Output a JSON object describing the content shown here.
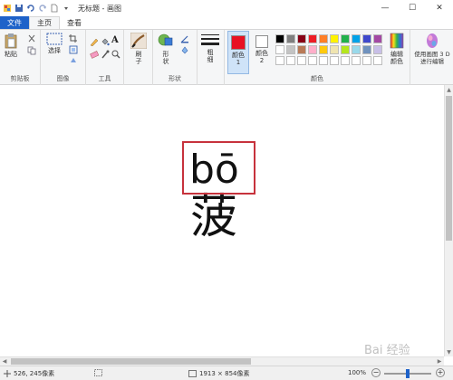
{
  "window": {
    "title": "无标题 - 画图",
    "controls": {
      "minimize": "—",
      "maximize": "☐",
      "close": "✕"
    }
  },
  "tabs": [
    {
      "label": "文件"
    },
    {
      "label": "主页"
    },
    {
      "label": "查看"
    }
  ],
  "ribbon": {
    "clipboard": {
      "paste_label": "粘贴",
      "group_label": "剪贴板"
    },
    "image": {
      "select_label": "选择",
      "group_label": "图像"
    },
    "tools": {
      "group_label": "工具",
      "text_glyph": "A"
    },
    "brushes": {
      "label": "刷子"
    },
    "shapes": {
      "shapes_label": "形状",
      "group_label": "形状"
    },
    "size": {
      "label": "粗细"
    },
    "colors": {
      "color1_label": "颜色 1",
      "color2_label": "颜色 2",
      "edit_label": "编辑颜色",
      "group_label": "颜色",
      "color1": "#e81123",
      "color2": "#ffffff",
      "palette_row1": [
        "#000000",
        "#7f7f7f",
        "#880015",
        "#ed1c24",
        "#ff7f27",
        "#fff200",
        "#22b14c",
        "#00a2e8",
        "#3f48cc",
        "#a349a4"
      ],
      "palette_row2": [
        "#ffffff",
        "#c3c3c3",
        "#b97a57",
        "#ffaec9",
        "#ffc90e",
        "#efe4b0",
        "#b5e61d",
        "#99d9ea",
        "#7092be",
        "#c8bfe7"
      ],
      "palette_row3": [
        "#ffffff",
        "#ffffff",
        "#ffffff",
        "#ffffff",
        "#ffffff",
        "#ffffff",
        "#ffffff",
        "#ffffff",
        "#ffffff",
        "#ffffff"
      ]
    },
    "paint3d": {
      "label": "使用画图 3 D 进行编辑"
    }
  },
  "canvas": {
    "pinyin": "bō",
    "hanzi": "菠",
    "highlight_color": "#c7323c"
  },
  "status": {
    "cursor": "526, 245像素",
    "dimensions": "1913 × 854像素",
    "zoom": "100%",
    "zoom_level": 1.0
  },
  "watermark": "Bai 经验"
}
